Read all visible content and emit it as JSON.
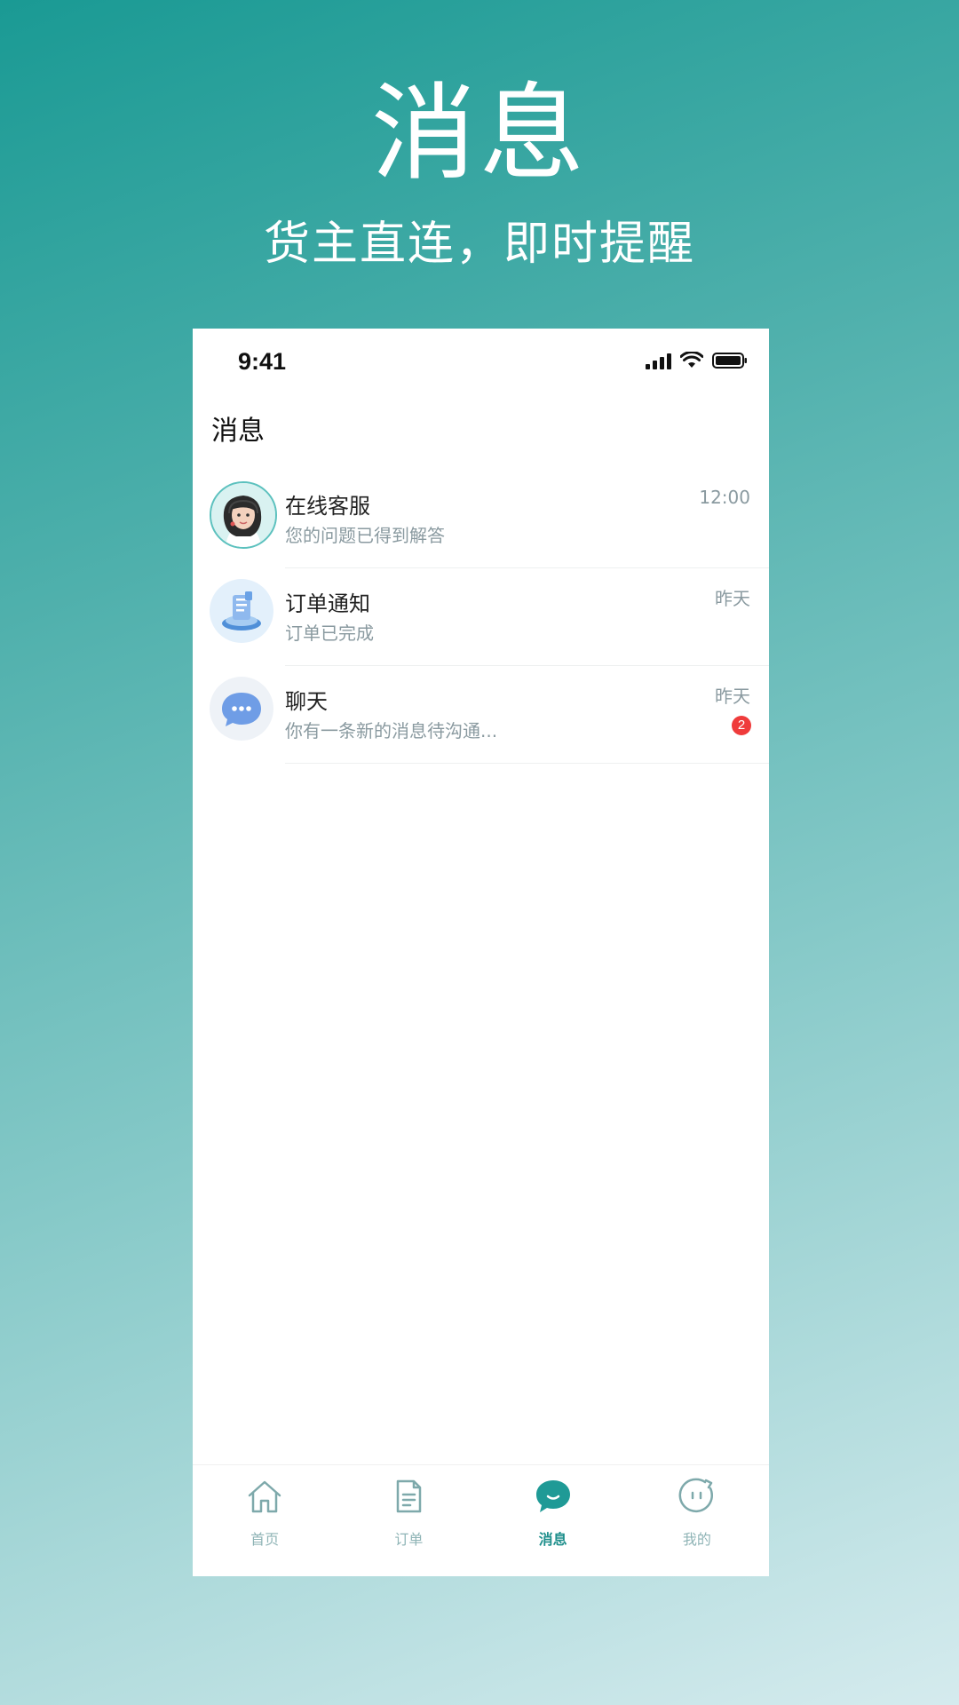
{
  "hero": {
    "title": "消息",
    "subtitle": "货主直连，即时提醒"
  },
  "status_bar": {
    "time": "9:41"
  },
  "page": {
    "title": "消息"
  },
  "messages": [
    {
      "name": "在线客服",
      "preview": "您的问题已得到解答",
      "time": "12:00",
      "icon": "customer-service-avatar-icon"
    },
    {
      "name": "订单通知",
      "preview": "订单已完成",
      "time": "昨天",
      "icon": "order-notification-icon"
    },
    {
      "name": "聊天",
      "preview": "你有一条新的消息待沟通...",
      "time": "昨天",
      "badge": "2",
      "icon": "chat-bubble-icon"
    }
  ],
  "tabbar": {
    "items": [
      {
        "label": "首页",
        "icon": "home-icon"
      },
      {
        "label": "订单",
        "icon": "document-icon"
      },
      {
        "label": "消息",
        "icon": "message-icon",
        "active": true
      },
      {
        "label": "我的",
        "icon": "profile-face-icon"
      }
    ]
  },
  "colors": {
    "accent": "#1f8f8c",
    "inactive_tab": "#8fb4b6",
    "badge": "#ef3b3b",
    "bg_gradient_start": "#1a9a94",
    "bg_gradient_end": "#d5ebee"
  }
}
